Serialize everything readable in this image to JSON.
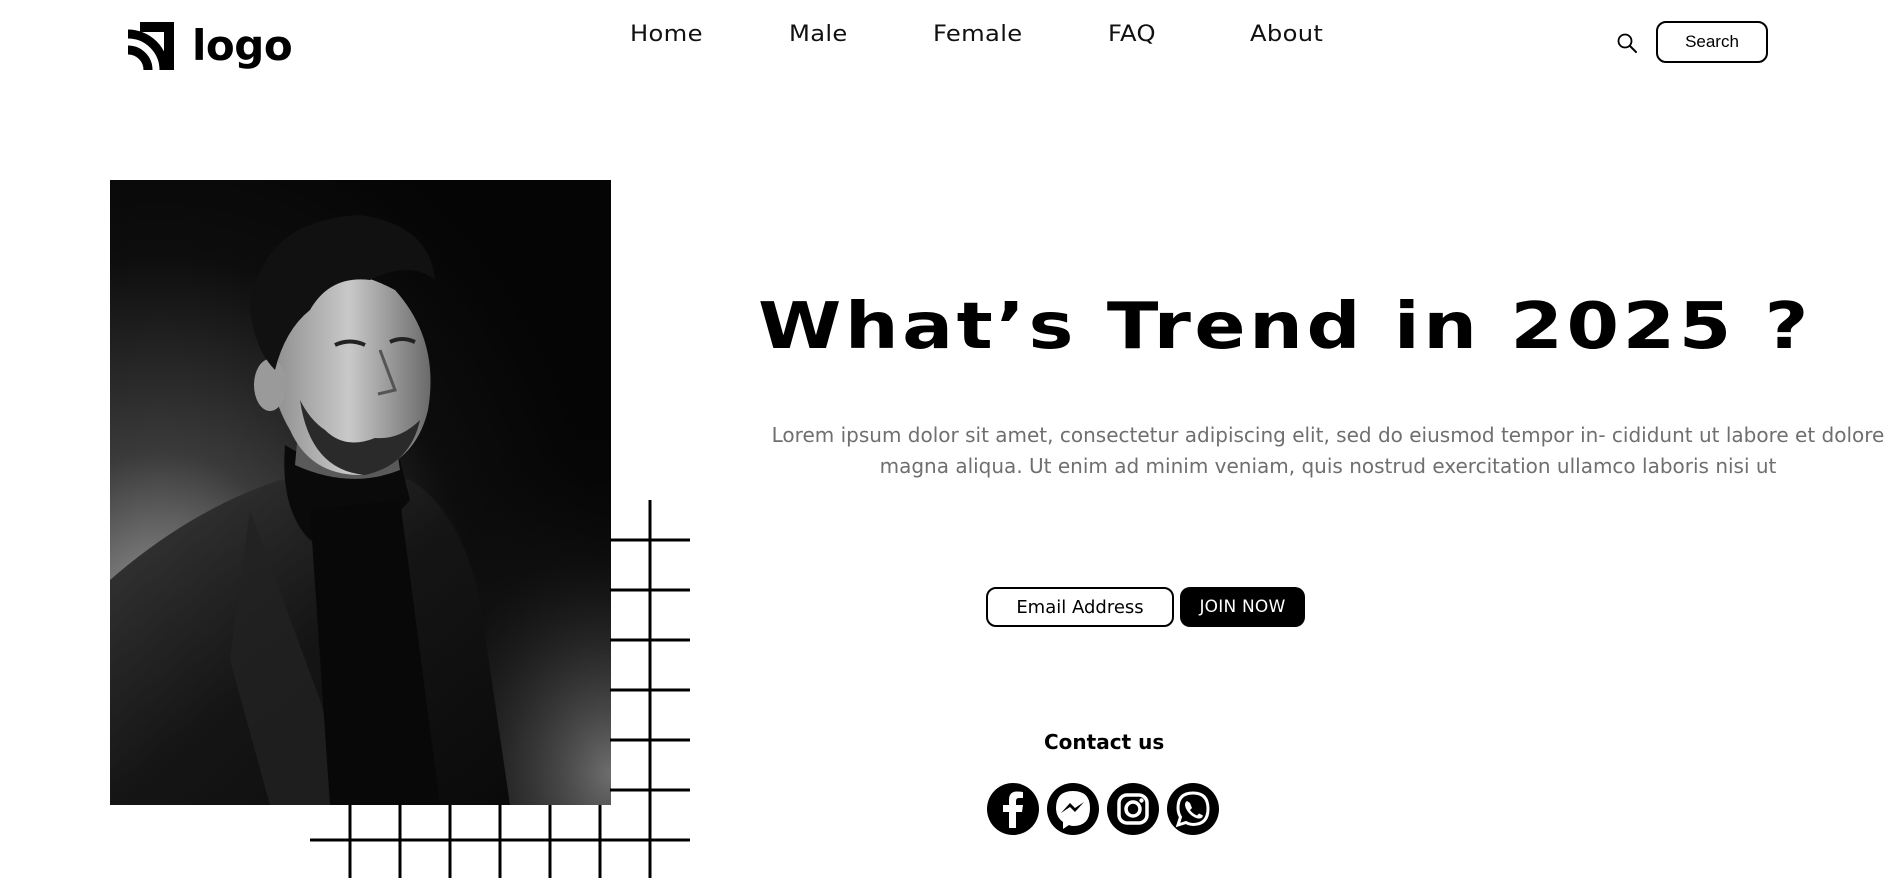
{
  "header": {
    "logo_text": "logo",
    "nav": [
      {
        "label": "Home"
      },
      {
        "label": "Male"
      },
      {
        "label": "Female"
      },
      {
        "label": "FAQ"
      },
      {
        "label": "About"
      }
    ],
    "search_icon": "search-icon",
    "search_label": "Search"
  },
  "hero": {
    "image": "portrait-of-man-in-black-turtleneck-and-blazer",
    "headline": "What’s Trend in 2025 ?",
    "subtext": "Lorem ipsum dolor sit amet, consectetur adipiscing elit, sed do eiusmod tempor in- cididunt ut labore et dolore magna aliqua. Ut enim ad minim veniam, quis nostrud exercitation ullamco laboris nisi ut"
  },
  "signup": {
    "email_placeholder": "Email Address",
    "join_label": "JOIN NOW"
  },
  "contact": {
    "title": "Contact us",
    "icons": [
      "facebook-icon",
      "messenger-icon",
      "instagram-icon",
      "whatsapp-icon"
    ]
  },
  "colors": {
    "text": "#000000",
    "muted": "#6f6f6f",
    "background": "#ffffff",
    "button": "#000000"
  }
}
